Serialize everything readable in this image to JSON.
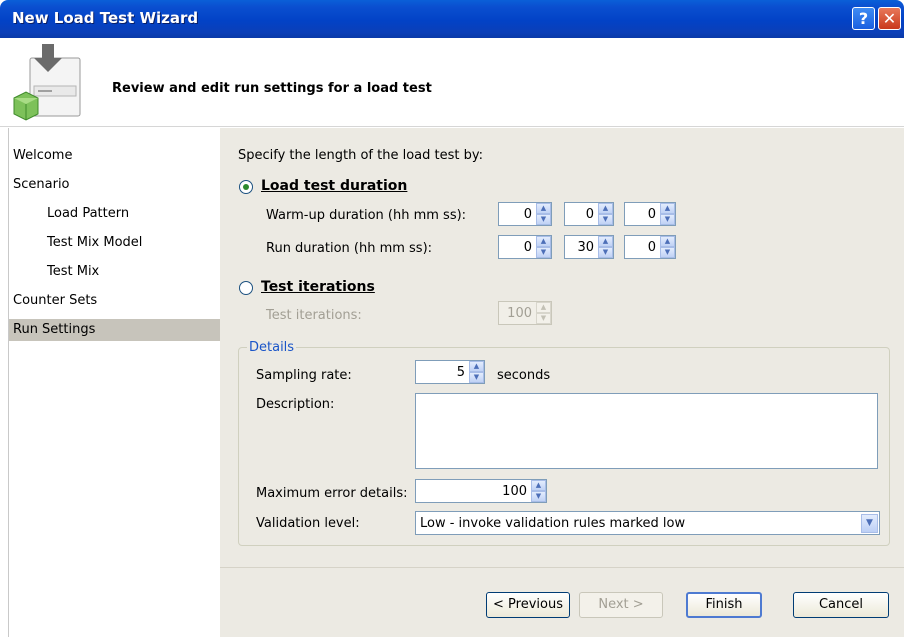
{
  "window": {
    "title": "New Load Test Wizard",
    "help_label": "?",
    "close_label": "✕"
  },
  "header": {
    "title": "Review and edit run settings for a load test",
    "icon": "load-test-wizard-icon"
  },
  "nav": {
    "items": [
      {
        "label": "Welcome"
      },
      {
        "label": "Scenario"
      },
      {
        "label": "Load Pattern"
      },
      {
        "label": "Test Mix Model"
      },
      {
        "label": "Test Mix"
      },
      {
        "label": "Counter Sets"
      },
      {
        "label": "Run Settings"
      }
    ]
  },
  "main": {
    "intro": "Specify the length of the load test by:",
    "duration": {
      "label": "Load test duration",
      "warmup_label": "Warm-up duration (hh mm ss):",
      "warmup": {
        "hh": "0",
        "mm": "0",
        "ss": "0"
      },
      "run_label": "Run duration (hh mm ss):",
      "run": {
        "hh": "0",
        "mm": "30",
        "ss": "0"
      }
    },
    "iterations": {
      "label": "Test iterations",
      "field_label": "Test iterations:",
      "value": "100"
    },
    "details": {
      "title": "Details",
      "sampling_label": "Sampling rate:",
      "sampling_value": "5",
      "sampling_unit": "seconds",
      "description_label": "Description:",
      "description_value": "",
      "max_errors_label": "Maximum error details:",
      "max_errors_value": "100",
      "validation_label": "Validation level:",
      "validation_value": "Low - invoke validation rules marked low"
    }
  },
  "footer": {
    "previous": "< Previous",
    "next": "Next >",
    "finish": "Finish",
    "cancel": "Cancel"
  }
}
